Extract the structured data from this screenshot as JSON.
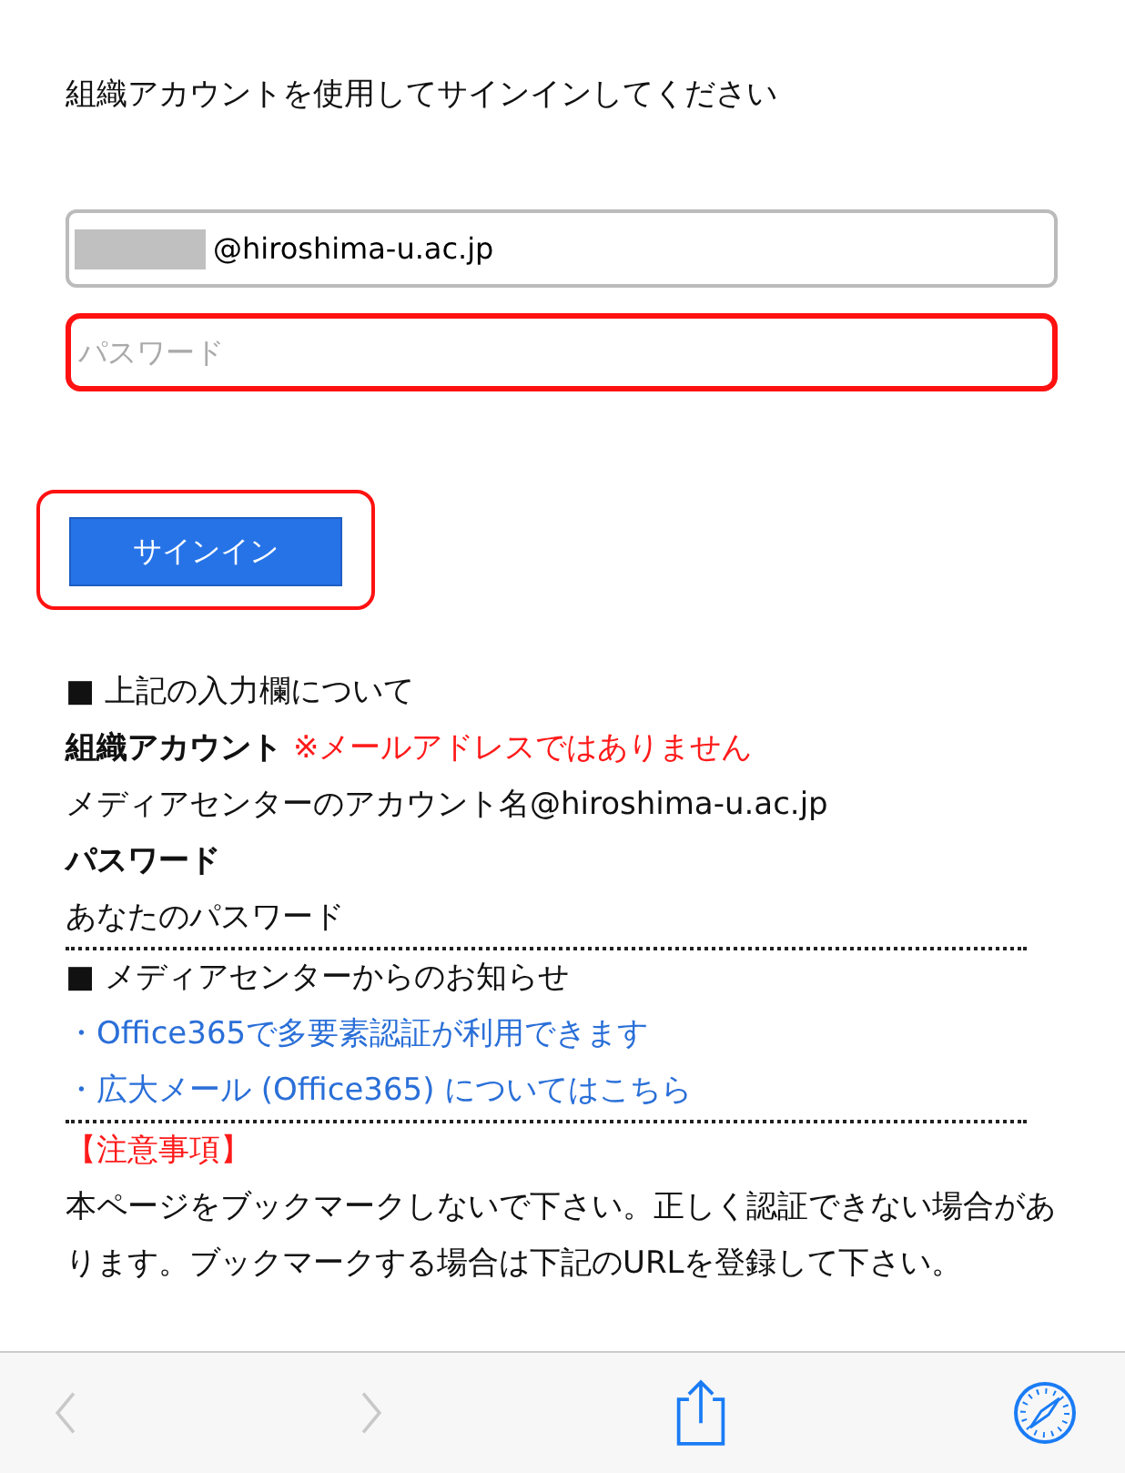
{
  "heading": "組織アカウントを使用してサインインしてください",
  "username": {
    "value": "@hiroshima-u.ac.jp",
    "redacted": true
  },
  "password": {
    "placeholder": "パスワード",
    "highlighted": true
  },
  "signin_button": {
    "label": "サインイン",
    "highlighted": true
  },
  "info": [
    {
      "kind": "section",
      "text": "■ 上記の入力欄について"
    },
    {
      "kind": "label",
      "text": "組織アカウント",
      "note": "※メールアドレスではありません"
    },
    {
      "kind": "plain",
      "text": "メディアセンターのアカウント名@hiroshima-u.ac.jp"
    },
    {
      "kind": "label",
      "text": "パスワード"
    },
    {
      "kind": "plain",
      "text": "あなたのパスワード"
    },
    {
      "kind": "divider"
    },
    {
      "kind": "section",
      "text": "■ メディアセンターからのお知らせ"
    },
    {
      "kind": "link",
      "text": "・Office365で多要素認証が利用できます"
    },
    {
      "kind": "link",
      "text": "・広大メール (Office365) についてはこちら"
    },
    {
      "kind": "divider"
    },
    {
      "kind": "warning",
      "text": "【注意事項】"
    },
    {
      "kind": "plain",
      "text": "本ページをブックマークしないで下さい。正しく認証できない場合があります。ブックマークする場合は下記のURLを登録して下さい。"
    }
  ],
  "toolbar": [
    {
      "kind": "back",
      "disabled": true
    },
    {
      "kind": "forward",
      "disabled": true
    },
    {
      "kind": "share",
      "disabled": false
    },
    {
      "kind": "compass",
      "disabled": false
    }
  ]
}
